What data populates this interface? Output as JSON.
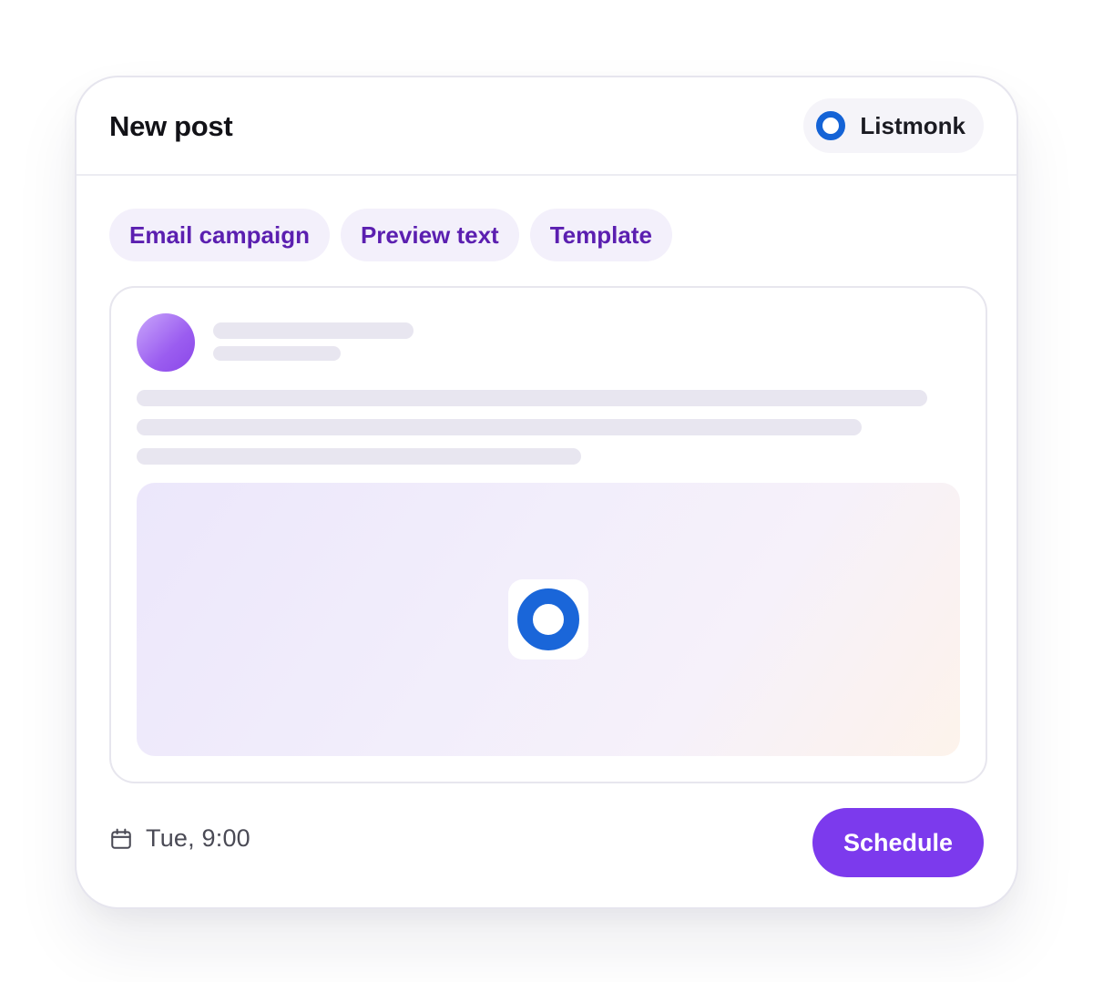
{
  "header": {
    "title": "New post",
    "account": {
      "label": "Listmonk",
      "icon": "listmonk-ring-icon",
      "color": "#1463d6"
    }
  },
  "chips": [
    {
      "label": "Email campaign"
    },
    {
      "label": "Preview text"
    },
    {
      "label": "Template"
    }
  ],
  "preview": {
    "media_icon": "listmonk-ring-icon"
  },
  "footer": {
    "calendar_icon": "calendar-icon",
    "time": "Tue, 9:00",
    "schedule_label": "Schedule"
  },
  "colors": {
    "accent": "#7c3aed",
    "chip_text": "#5b1fb0",
    "chip_bg": "#f3f0fb",
    "skeleton": "#e8e6f0"
  }
}
